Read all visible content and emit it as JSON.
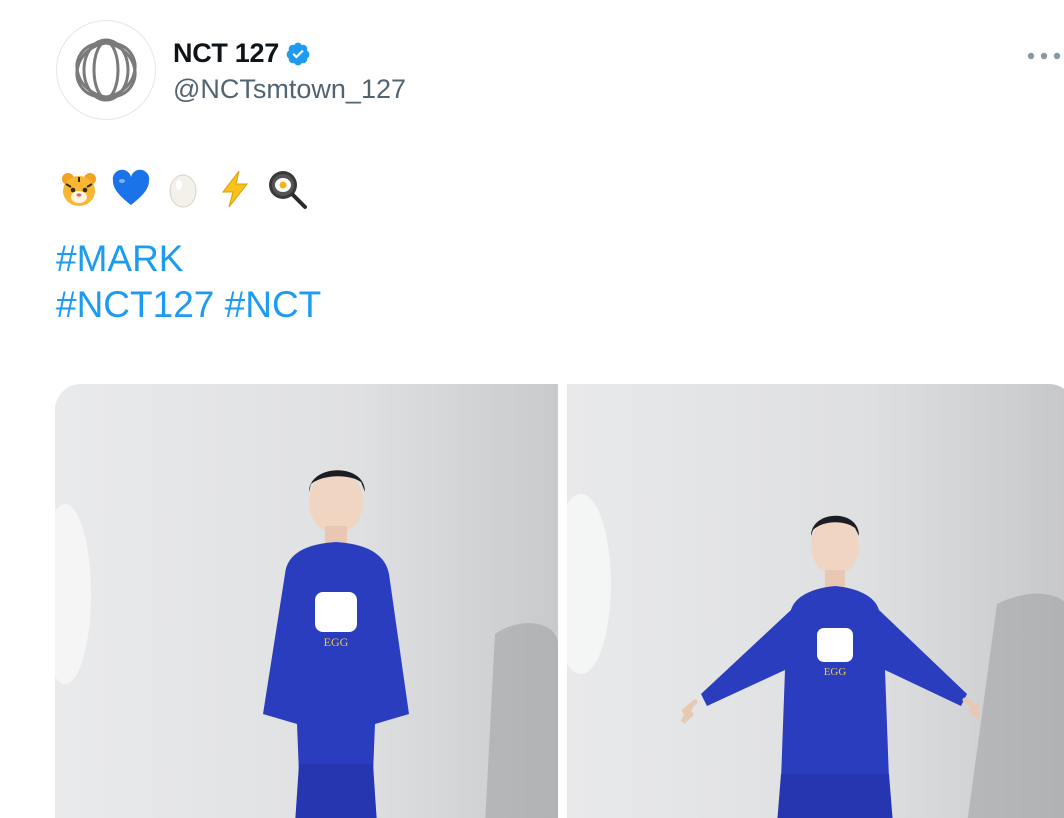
{
  "account": {
    "display_name": "NCT 127",
    "handle": "@NCTsmtown_127",
    "verified": true,
    "avatar_icon": "nct-logo-icon",
    "verified_icon": "verified-badge-icon",
    "more_icon": "more-options-icon"
  },
  "tweet": {
    "emojis": [
      {
        "name": "tiger-face-emoji",
        "char": "🐯"
      },
      {
        "name": "blue-heart-emoji",
        "char": "💙"
      },
      {
        "name": "egg-emoji",
        "char": "🥚"
      },
      {
        "name": "lightning-emoji",
        "char": "⚡"
      },
      {
        "name": "frying-pan-emoji",
        "char": "🍳"
      }
    ],
    "hashtags_line1": [
      "#MARK"
    ],
    "hashtags_line2": [
      "#NCT127",
      "#NCT"
    ],
    "photos": [
      {
        "name": "photo-1",
        "logo_text": "EGG"
      },
      {
        "name": "photo-2",
        "logo_text": "EGG"
      }
    ]
  },
  "colors": {
    "link": "#1d9bf0",
    "verified": "#1d9bf0",
    "handle": "#536471",
    "hoodie": "#2b3dbf"
  }
}
